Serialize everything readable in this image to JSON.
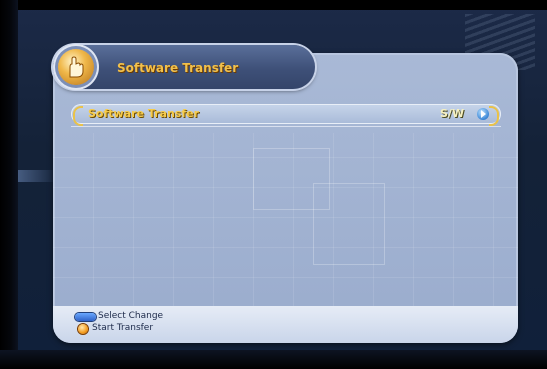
{
  "window": {
    "title": "Software Transfer"
  },
  "menu": {
    "items": [
      {
        "label": "Software Transfer",
        "value": "S/W"
      }
    ]
  },
  "footer": {
    "legend": [
      {
        "icon": "nav-keys-icon",
        "text": "Select Change"
      },
      {
        "icon": "ok-button-icon",
        "text": "Start Transfer"
      }
    ]
  },
  "colors": {
    "title_text": "#f2c04a",
    "panel": "#a9b9d6",
    "highlight_border": "#e9c24a",
    "nav_key": "#2f63c9",
    "ok_key": "#f39b1d"
  }
}
